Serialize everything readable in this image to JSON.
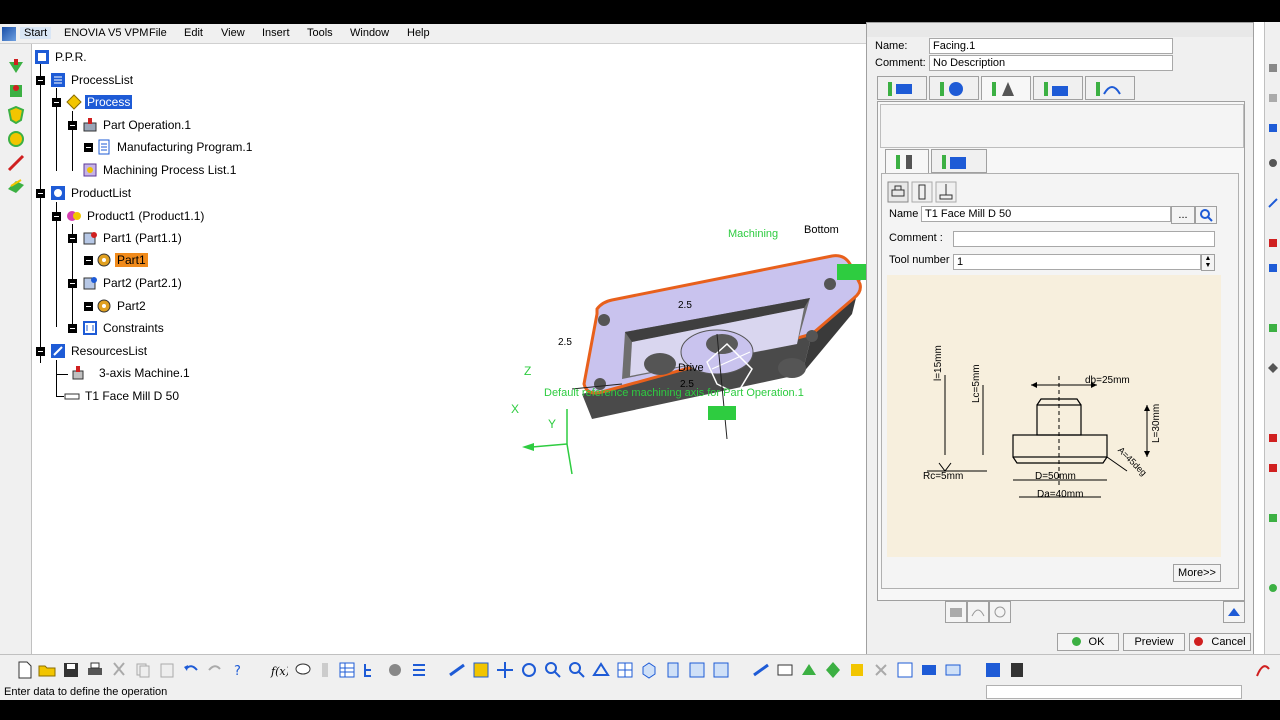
{
  "menubar": {
    "start": "Start",
    "items": [
      "ENOVIA V5 VPM",
      "File",
      "Edit",
      "View",
      "Insert",
      "Tools",
      "Window",
      "Help"
    ]
  },
  "tree": {
    "root": "P.P.R.",
    "process_list": "ProcessList",
    "process": "Process",
    "part_operation": "Part Operation.1",
    "manufacturing_program": "Manufacturing Program.1",
    "machining_process_list": "Machining Process List.1",
    "product_list": "ProductList",
    "product1": "Product1 (Product1.1)",
    "part1_instance": "Part1 (Part1.1)",
    "part1": "Part1",
    "part2_instance": "Part2 (Part2.1)",
    "part2": "Part2",
    "constraints": "Constraints",
    "resources_list": "ResourcesList",
    "machine": "3-axis Machine.1",
    "tool": "T1 Face Mill D 50"
  },
  "viewport": {
    "machining_label": "Machining",
    "bottom_tag": "Bottom",
    "drive_tag": "Drive",
    "axis_label": "Default reference machining axis for Part Operation.1",
    "dim_left": "2.5",
    "dim_top": "2.5",
    "dim_bottom": "2.5",
    "axis_x": "X",
    "axis_y": "Y",
    "axis_z": "Z"
  },
  "dialog": {
    "name_label": "Name:",
    "name_value": "Facing.1",
    "comment_label": "Comment:",
    "comment_value": "No Description",
    "tool": {
      "name_label": "Name",
      "name_value": "T1 Face Mill D 50",
      "browse_label": "...",
      "comment_label": "Comment :",
      "comment_value": "",
      "tool_number_label": "Tool number :",
      "tool_number_value": "1"
    },
    "drawing": {
      "db": "db=25mm",
      "l": "l=15mm",
      "lc": "Lc=5mm",
      "L": "L=30mm",
      "A": "A=45deg",
      "Rc": "Rc=5mm",
      "D": "D=50mm",
      "Da": "Da=40mm"
    },
    "more_button": "More>>",
    "ok_button": "OK",
    "preview_button": "Preview",
    "cancel_button": "Cancel"
  },
  "status": {
    "message": "Enter data to define the operation"
  },
  "colors": {
    "selection_blue": "#1e5bd6",
    "selection_orange": "#f08a1a",
    "annotation_green": "#2ecc40",
    "part_highlight": "#e8601c"
  }
}
